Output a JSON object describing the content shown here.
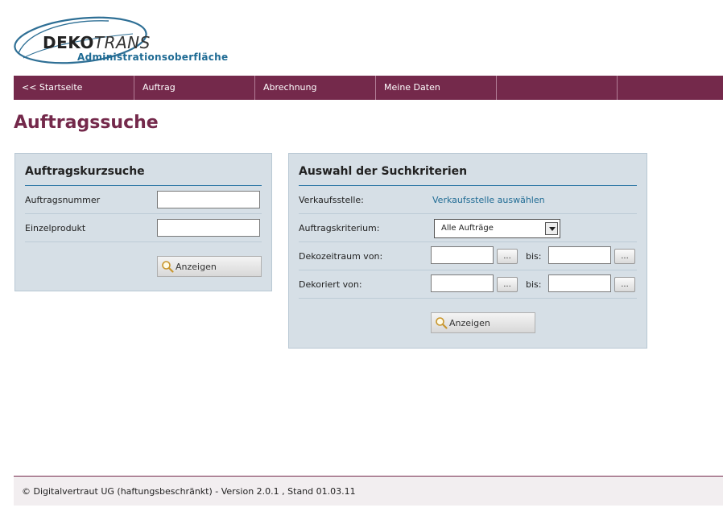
{
  "logo": {
    "brand_bold": "DEKO",
    "brand_italic": "TRANS",
    "subtitle": "Administrationsoberfläche"
  },
  "nav": {
    "items": [
      {
        "label": "<< Startseite"
      },
      {
        "label": "Auftrag"
      },
      {
        "label": "Abrechnung"
      },
      {
        "label": "Meine Daten"
      },
      {
        "label": ""
      }
    ]
  },
  "page_title": "Auftragssuche",
  "quick_search": {
    "title": "Auftragskurzsuche",
    "order_number_label": "Auftragsnummer",
    "order_number_value": "",
    "single_product_label": "Einzelprodukt",
    "single_product_value": "",
    "submit_label": "Anzeigen"
  },
  "criteria": {
    "title": "Auswahl der Suchkriterien",
    "store_label": "Verkaufsstelle:",
    "store_link": "Verkaufsstelle auswählen",
    "criterion_label": "Auftragskriterium:",
    "criterion_selected": "Alle Aufträge",
    "deco_period_label": "Dekozeitraum von:",
    "deco_period_from": "",
    "deco_period_to": "",
    "decorated_label": "Dekoriert von:",
    "decorated_from": "",
    "decorated_to": "",
    "to_label": "bis:",
    "picker_label": "...",
    "submit_label": "Anzeigen"
  },
  "footer": {
    "text": "© Digitalvertraut UG (haftungsbeschränkt) - Version 2.0.1 , Stand 01.03.11"
  },
  "colors": {
    "accent": "#74294b",
    "link": "#1f6b94",
    "panel_bg": "#d6dfe6"
  }
}
